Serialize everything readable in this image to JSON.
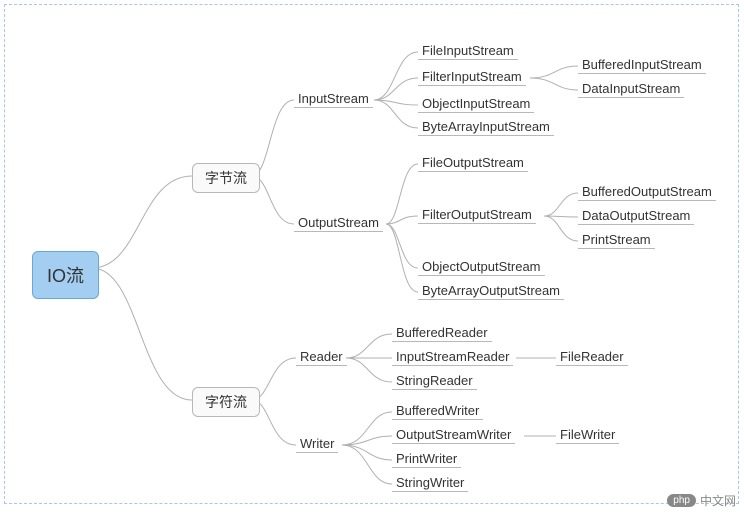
{
  "chart_data": {
    "type": "tree",
    "title": "IO流",
    "root": {
      "name": "IO流",
      "children": [
        {
          "name": "字节流",
          "children": [
            {
              "name": "InputStream",
              "children": [
                {
                  "name": "FileInputStream"
                },
                {
                  "name": "FilterInputStream",
                  "children": [
                    {
                      "name": "BufferedInputStream"
                    },
                    {
                      "name": "DataInputStream"
                    }
                  ]
                },
                {
                  "name": "ObjectInputStream"
                },
                {
                  "name": "ByteArrayInputStream"
                }
              ]
            },
            {
              "name": "OutputStream",
              "children": [
                {
                  "name": "FileOutputStream"
                },
                {
                  "name": "FilterOutputStream",
                  "children": [
                    {
                      "name": "BufferedOutputStream"
                    },
                    {
                      "name": "DataOutputStream"
                    },
                    {
                      "name": "PrintStream"
                    }
                  ]
                },
                {
                  "name": "ObjectOutputStream"
                },
                {
                  "name": "ByteArrayOutputStream"
                }
              ]
            }
          ]
        },
        {
          "name": "字符流",
          "children": [
            {
              "name": "Reader",
              "children": [
                {
                  "name": "BufferedReader"
                },
                {
                  "name": "InputStreamReader",
                  "children": [
                    {
                      "name": "FileReader"
                    }
                  ]
                },
                {
                  "name": "StringReader"
                }
              ]
            },
            {
              "name": "Writer",
              "children": [
                {
                  "name": "BufferedWriter"
                },
                {
                  "name": "OutputStreamWriter",
                  "children": [
                    {
                      "name": "FileWriter"
                    }
                  ]
                },
                {
                  "name": "PrintWriter"
                },
                {
                  "name": "StringWriter"
                }
              ]
            }
          ]
        }
      ]
    }
  },
  "root": "IO流",
  "byte_stream": "字节流",
  "char_stream": "字符流",
  "input_stream": "InputStream",
  "output_stream": "OutputStream",
  "reader": "Reader",
  "writer": "Writer",
  "is_file": "FileInputStream",
  "is_filter": "FilterInputStream",
  "is_buf": "BufferedInputStream",
  "is_data": "DataInputStream",
  "is_obj": "ObjectInputStream",
  "is_ba": "ByteArrayInputStream",
  "os_file": "FileOutputStream",
  "os_filter": "FilterOutputStream",
  "os_buf": "BufferedOutputStream",
  "os_data": "DataOutputStream",
  "os_print": "PrintStream",
  "os_obj": "ObjectOutputStream",
  "os_ba": "ByteArrayOutputStream",
  "r_buf": "BufferedReader",
  "r_isr": "InputStreamReader",
  "r_file": "FileReader",
  "r_str": "StringReader",
  "w_buf": "BufferedWriter",
  "w_osw": "OutputStreamWriter",
  "w_file": "FileWriter",
  "w_print": "PrintWriter",
  "w_str": "StringWriter",
  "watermark_badge": "php",
  "watermark_text": "中文网"
}
